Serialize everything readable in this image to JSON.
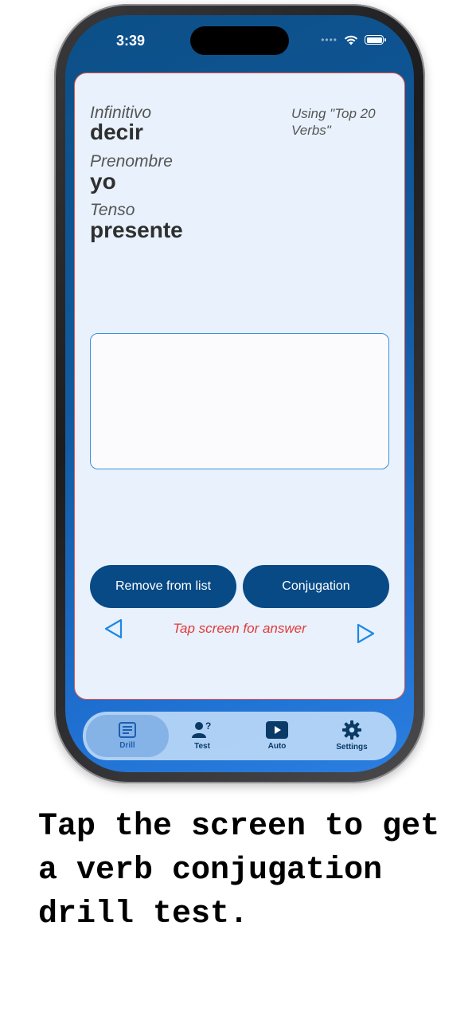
{
  "status_bar": {
    "time": "3:39"
  },
  "card": {
    "infinitive_label": "Infinitivo",
    "infinitive_value": "decir",
    "pronoun_label": "Prenombre",
    "pronoun_value": "yo",
    "tense_label": "Tenso",
    "tense_value": "presente",
    "deck_note": "Using \"Top 20 Verbs\"",
    "answer_text": "",
    "remove_button": "Remove from list",
    "conjugation_button": "Conjugation",
    "hint": "Tap screen for answer"
  },
  "tabbar": {
    "items": [
      {
        "label": "Drill",
        "icon": "list-icon",
        "active": true
      },
      {
        "label": "Test",
        "icon": "person-question-icon",
        "active": false
      },
      {
        "label": "Auto",
        "icon": "play-icon",
        "active": false
      },
      {
        "label": "Settings",
        "icon": "gear-icon",
        "active": false
      }
    ]
  },
  "colors": {
    "accent": "#074a86",
    "card_background": "#e8f1fc",
    "card_border": "#e2584e",
    "hint": "#e23a3a",
    "arrow": "#1e88e5"
  },
  "caption": "Tap the screen to get a verb conjugation drill test."
}
